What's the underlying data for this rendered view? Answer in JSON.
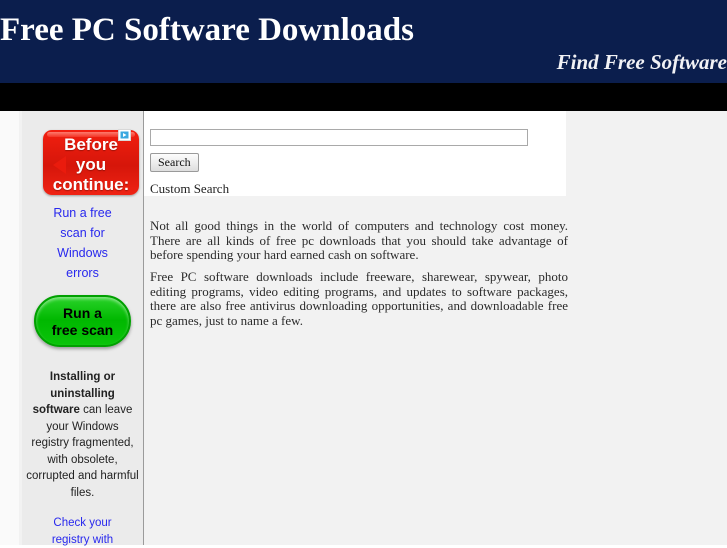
{
  "header": {
    "title": "Free PC Software Downloads",
    "tagline": "Find Free Software",
    "bg_color": "#0b1e4d",
    "rule_color": "#000000"
  },
  "sidebar_ad": {
    "adchoices_icon": "adchoices-triangle-icon",
    "bubble_text": "Before\nyou\ncontinue:",
    "bubble_color": "#e8190b",
    "link_text": "Run a free scan for Windows errors",
    "link_color": "#2828ee",
    "button_label": "Run a free scan",
    "button_color": "#00b800",
    "body_bold_1": "Installing or uninstalling software",
    "body_rest": " can leave your Windows registry fragmented, with obsolete, corrupted and harmful files.",
    "footer_link": "Check your registry with"
  },
  "search": {
    "input_value": "",
    "placeholder": "",
    "button_label": "Search",
    "custom_search_label": "Custom Search"
  },
  "main": {
    "paragraphs": [
      "Not all good things in the world of computers and technology cost money. There are all kinds of free pc downloads that you should take advantage of before spending your hard earned cash on software.",
      "Free PC software downloads include freeware, sharewear, spywear, photo editing programs, video editing programs, and updates to software packages, there are also free antivirus downloading opportunities, and downloadable free pc games, just to name a few."
    ]
  }
}
